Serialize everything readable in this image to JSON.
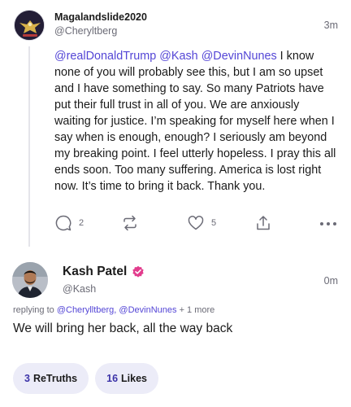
{
  "post": {
    "author_name": "Magalandslide2020",
    "author_handle": "@Cheryltberg",
    "time": "3m",
    "mentions": [
      "@realDonaldTrump",
      "@Kash",
      "@DevinNunes"
    ],
    "text": " I know none of you will probably see this, but I am so upset and I have something to say. So many Patriots have put their full trust in all of you. We are anxiously waiting for justice. I’m speaking for myself here when I say when is enough, enough? I seriously am beyond my breaking point. I feel utterly hopeless. I pray this all ends soon. Too many suffering. America is lost right now. It’s time to bring it back. Thank you.",
    "actions": {
      "reply_count": "2",
      "like_count": "5"
    },
    "icons": {
      "reply": "comment-icon",
      "retruth": "retruth-icon",
      "like": "heart-icon",
      "share": "share-icon",
      "more": "more-options-icon"
    }
  },
  "reply": {
    "author_name": "Kash Patel",
    "verified_icon": "verified-badge-icon",
    "author_handle": "@Kash",
    "time": "0m",
    "replying_prefix": "replying to",
    "replying_mentions": [
      "@Cherylltberg,",
      "@DevinNunes"
    ],
    "replying_suffix": "+ 1 more",
    "text": "We will bring her back, all the way back",
    "stats": {
      "retruths_count": "3",
      "retruths_label": "ReTruths",
      "likes_count": "16",
      "likes_label": "Likes"
    }
  },
  "colors": {
    "accent": "#5446d6",
    "muted": "#6b6b76",
    "verified": "#e23c8d",
    "pill_bg": "#ececf8"
  }
}
